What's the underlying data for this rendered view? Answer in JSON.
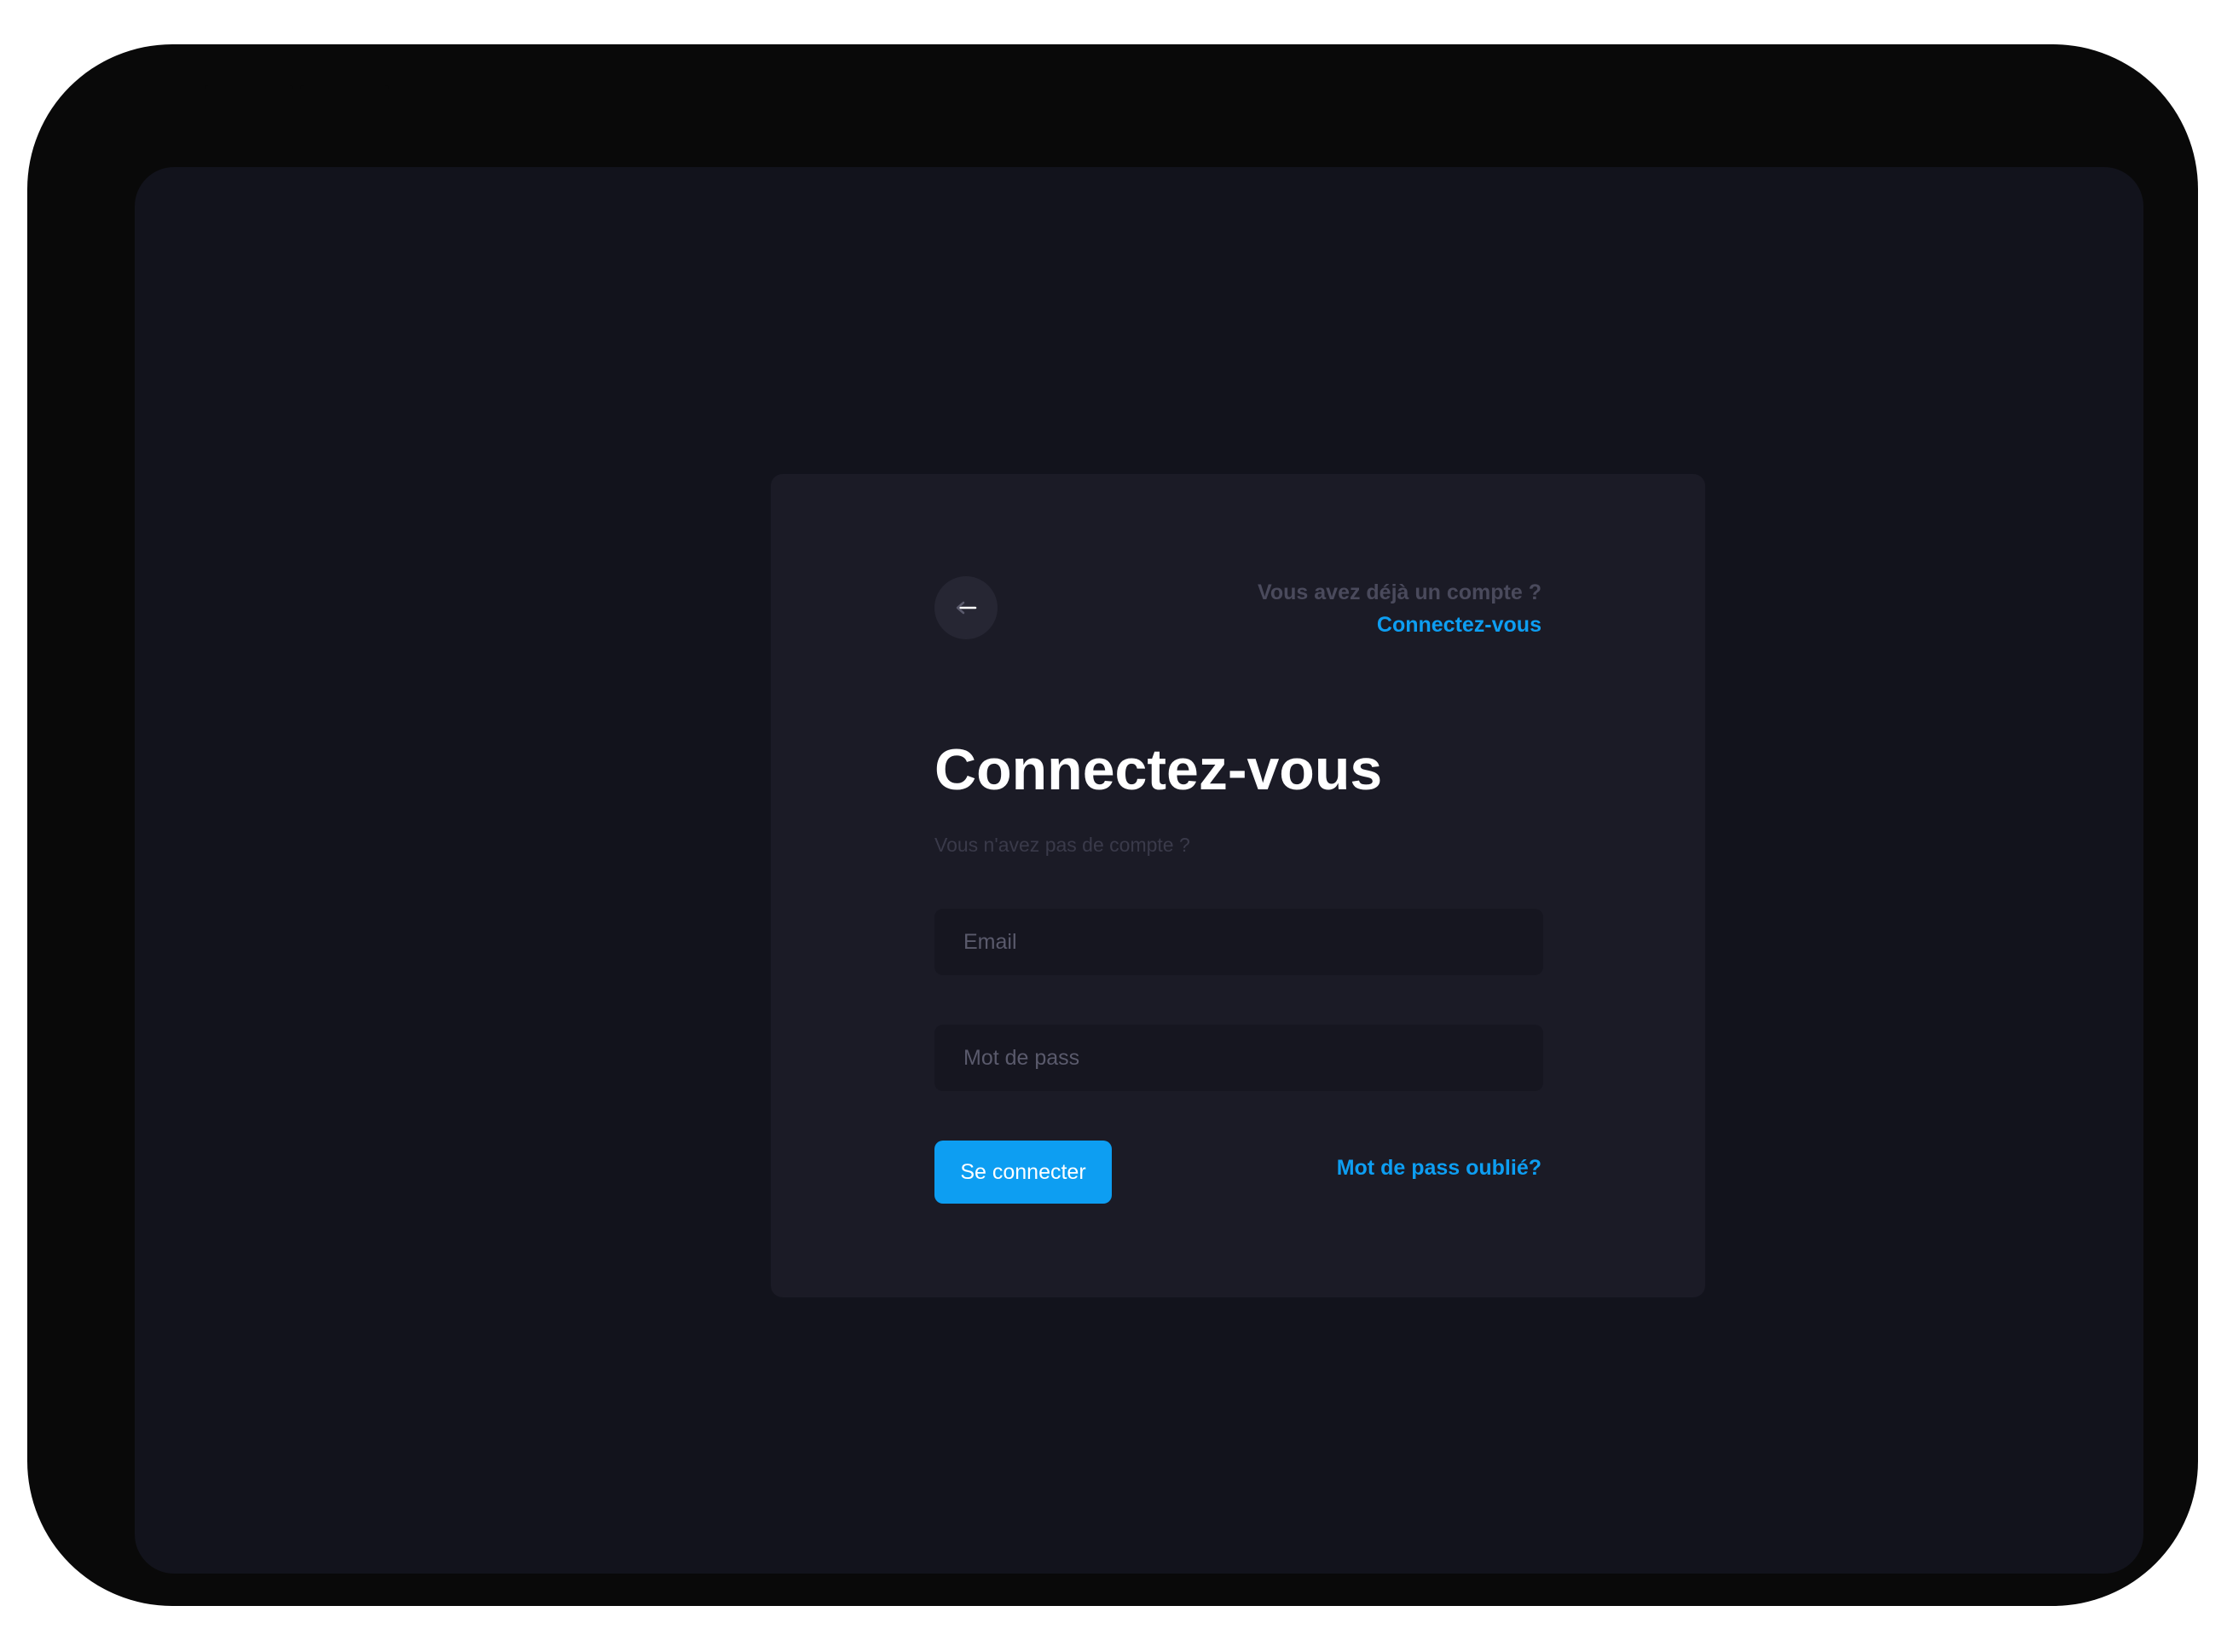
{
  "header": {
    "back_icon": "arrow-left-icon",
    "account_question": "Vous avez déjà un compte ?",
    "account_link": "Connectez-vous"
  },
  "form": {
    "title": "Connectez-vous",
    "subtitle": "Vous n'avez pas de compte ?",
    "email": {
      "value": "",
      "placeholder": "Email"
    },
    "password": {
      "value": "",
      "placeholder": "Mot de pass"
    },
    "submit_label": "Se connecter",
    "forgot_label": "Mot de pass oublié?"
  },
  "colors": {
    "device_frame": "#090909",
    "screen_background": "#12131c",
    "card_background": "#1b1b26",
    "input_background": "#161620",
    "accent": "#0d9ef2",
    "muted_text": "#4a4a5c",
    "title_text": "#ffffff"
  }
}
